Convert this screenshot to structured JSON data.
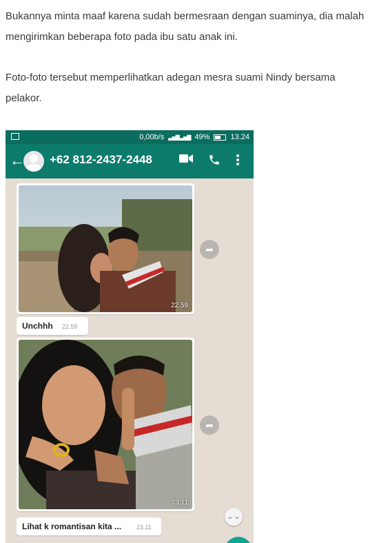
{
  "article": {
    "paragraph1": "Bukannya minta maaf karena sudah bermesraan dengan suaminya, dia malah mengirimkan beberapa foto pada ibu satu anak ini.",
    "paragraph2": "Foto-foto tersebut memperlihatkan adegan mesra suami Nindy bersama pelakor."
  },
  "status_bar": {
    "network_speed": "0,00b/s",
    "signal": "▃▅▇ ▃▅▇",
    "battery": "49%",
    "time": "13.24"
  },
  "header": {
    "back_icon": "arrow-left-icon",
    "contact_name": "+62 812-2437-2448",
    "video_icon": "video-camera-icon",
    "call_icon": "phone-icon",
    "menu_icon": "more-vertical-icon"
  },
  "messages": [
    {
      "image_time": "22.59",
      "caption": "Unchhh",
      "caption_time": "22.59"
    },
    {
      "image_time": "23.11",
      "caption": "Lihat k romantisan kita ...",
      "caption_time": "23.11"
    }
  ],
  "colors": {
    "header_bg": "#0d7b6b",
    "status_bg": "#0b6d5f",
    "chat_bg": "#e5ddd3",
    "fab": "#11a591"
  }
}
